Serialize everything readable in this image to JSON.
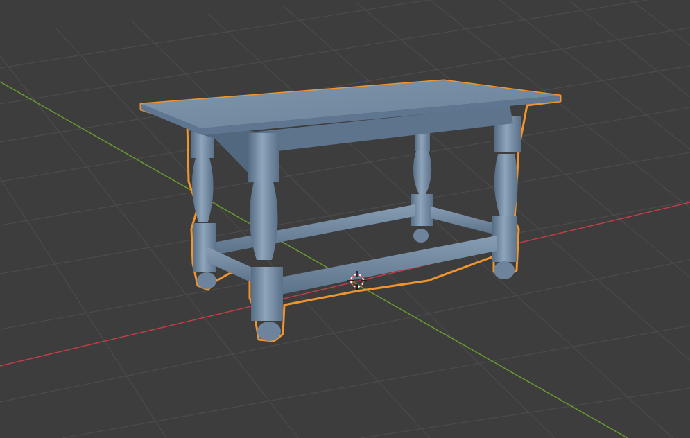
{
  "viewport": {
    "background_color": "#3d3d3d",
    "grid_color": "#4b4b4b",
    "x_axis_color": "#c33d48",
    "y_axis_color": "#6a9a2e",
    "selection_outline_color": "#f0952d",
    "object_color": "#6a829a",
    "object_highlight_color": "#8ca3b8",
    "object_shadow_color": "#4f6378"
  },
  "selected_object": {
    "type": "mesh",
    "description_icon": "table-mesh",
    "selected": true
  },
  "cursor_3d": {
    "icon": "3d-cursor-icon",
    "ring_colors": [
      "#ff4444",
      "#ffffff"
    ]
  }
}
